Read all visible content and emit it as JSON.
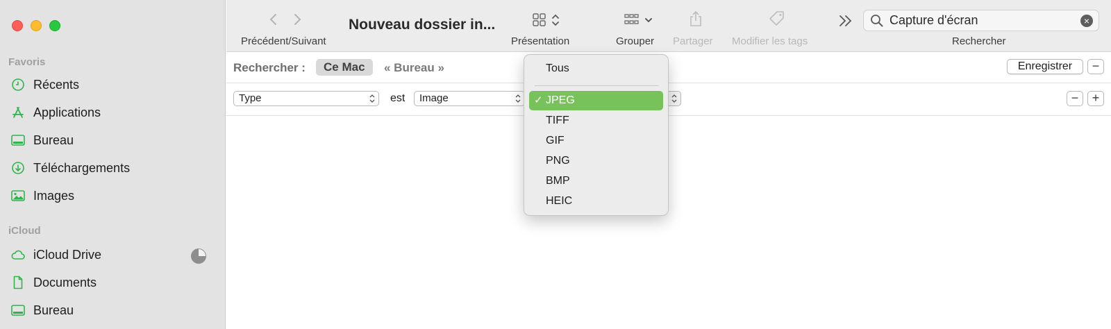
{
  "sidebar": {
    "sections": [
      {
        "title": "Favoris"
      },
      {
        "title": "iCloud"
      }
    ],
    "items": [
      {
        "label": "Récents",
        "icon": "clock-icon"
      },
      {
        "label": "Applications",
        "icon": "applications-icon"
      },
      {
        "label": "Bureau",
        "icon": "desktop-icon"
      },
      {
        "label": "Téléchargements",
        "icon": "download-icon"
      },
      {
        "label": "Images",
        "icon": "photo-icon"
      },
      {
        "label": "iCloud Drive",
        "icon": "cloud-icon"
      },
      {
        "label": "Documents",
        "icon": "document-icon"
      },
      {
        "label": "Bureau",
        "icon": "desktop-icon"
      }
    ],
    "accent_color": "#2fb44c"
  },
  "toolbar": {
    "nav_label": "Précédent/Suivant",
    "title": "Nouveau dossier in...",
    "view_label": "Présentation",
    "group_label": "Grouper",
    "share_label": "Partager",
    "tags_label": "Modifier les tags",
    "search_label": "Rechercher",
    "search_value": "Capture d'écran"
  },
  "scope": {
    "label": "Rechercher :",
    "this_mac": "Ce Mac",
    "folder": "« Bureau »",
    "save_label": "Enregistrer"
  },
  "criteria": {
    "attribute": "Type",
    "operator": "est",
    "value": "Image"
  },
  "menu": {
    "items": [
      "Tous",
      "JPEG",
      "TIFF",
      "GIF",
      "PNG",
      "BMP",
      "HEIC"
    ],
    "selected": "JPEG",
    "check": "✓",
    "highlight_color": "#78c25c"
  }
}
